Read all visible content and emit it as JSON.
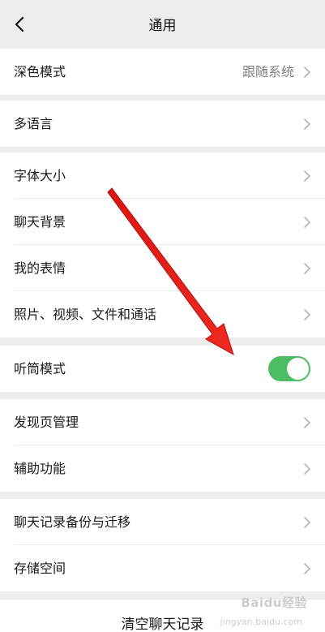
{
  "header": {
    "title": "通用",
    "back_icon": "chevron-left-icon"
  },
  "groups": [
    {
      "items": [
        {
          "label": "深色模式",
          "value": "跟随系统"
        }
      ]
    },
    {
      "items": [
        {
          "label": "多语言"
        }
      ]
    },
    {
      "items": [
        {
          "label": "字体大小"
        },
        {
          "label": "聊天背景"
        },
        {
          "label": "我的表情"
        },
        {
          "label": "照片、视频、文件和通话"
        }
      ]
    },
    {
      "items": [
        {
          "label": "听筒模式",
          "toggle_on": true
        }
      ]
    },
    {
      "items": [
        {
          "label": "发现页管理"
        },
        {
          "label": "辅助功能"
        }
      ]
    },
    {
      "items": [
        {
          "label": "聊天记录备份与迁移"
        },
        {
          "label": "存储空间"
        }
      ]
    }
  ],
  "footer": {
    "clear_label": "清空聊天记录"
  },
  "annotation": {
    "arrow_color": "#e8201c"
  },
  "watermark": {
    "brand": "Baidu经验",
    "url": "jingyan.baidu.com"
  },
  "colors": {
    "toggle_on": "#4dbd63",
    "background": "#ededed"
  }
}
